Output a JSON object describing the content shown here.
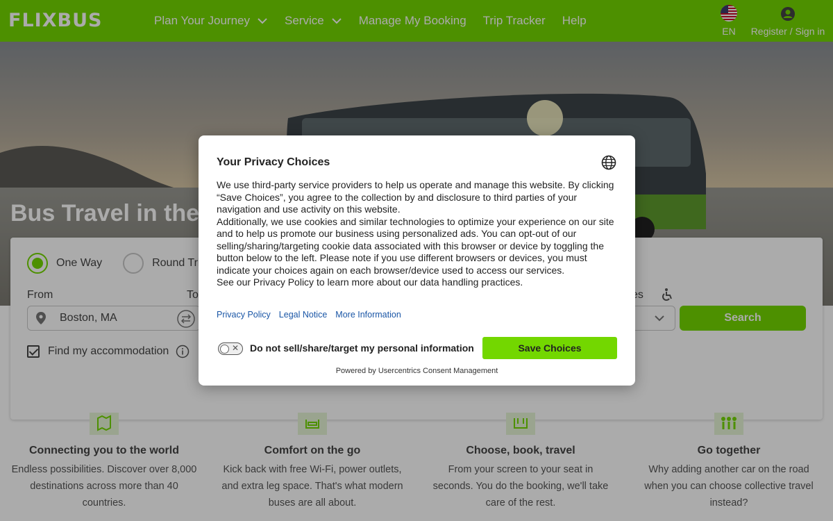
{
  "header": {
    "logo": "FLIXBUS",
    "nav": [
      {
        "label": "Plan Your Journey",
        "dropdown": true
      },
      {
        "label": "Service",
        "dropdown": true
      },
      {
        "label": "Manage My Booking",
        "dropdown": false
      },
      {
        "label": "Trip Tracker",
        "dropdown": false
      },
      {
        "label": "Help",
        "dropdown": false
      }
    ],
    "language": "EN",
    "account": "Register / Sign in"
  },
  "hero": {
    "title": "Bus Travel in the U"
  },
  "search": {
    "trip_types": [
      {
        "label": "One Way",
        "selected": true
      },
      {
        "label": "Round Trip",
        "selected": false
      }
    ],
    "from_label": "From",
    "to_label": "To",
    "from_value": "Boston, MA",
    "passengers_label_fragment": "es",
    "search_button": "Search",
    "accommodation_label": "Find my accommodation",
    "accommodation_checked": true
  },
  "features": [
    {
      "icon": "map-icon",
      "title": "Connecting you to the world",
      "text": "Endless possibilities. Discover over 8,000 destinations across more than 40 countries."
    },
    {
      "icon": "seat-icon",
      "title": "Comfort on the go",
      "text": "Kick back with free Wi-Fi, power outlets, and extra leg space. That's what modern buses are all about."
    },
    {
      "icon": "ticket-icon",
      "title": "Choose, book, travel",
      "text": "From your screen to your seat in seconds. You do the booking, we'll take care of the rest."
    },
    {
      "icon": "group-icon",
      "title": "Go together",
      "text": "Why adding another car on the road when you can choose collective travel instead?"
    }
  ],
  "consent": {
    "title": "Your Privacy Choices",
    "paragraphs": [
      "We use third-party service providers to help us operate and manage this website. By clicking “Save Choices”, you agree to the collection by and disclosure to third parties of your navigation and use activity on this website.",
      "Additionally, we use cookies and similar technologies to optimize your experience on our site and to help us promote our business using personalized ads. You can opt-out of our selling/sharing/targeting cookie data associated with this browser or device by toggling the button below to the left. Please note if you use different browsers or devices, you must indicate your choices again on each browser/device used to access our services.",
      "See our Privacy Policy to learn more about our data handling practices."
    ],
    "links": [
      "Privacy Policy",
      "Legal Notice",
      "More Information"
    ],
    "toggle_label": "Do not sell/share/target my personal information",
    "toggle_on": false,
    "save_button": "Save Choices",
    "powered_by": "Powered by Usercentrics Consent Management"
  },
  "colors": {
    "brand_green": "#73d700",
    "link_blue": "#1a56a6"
  }
}
